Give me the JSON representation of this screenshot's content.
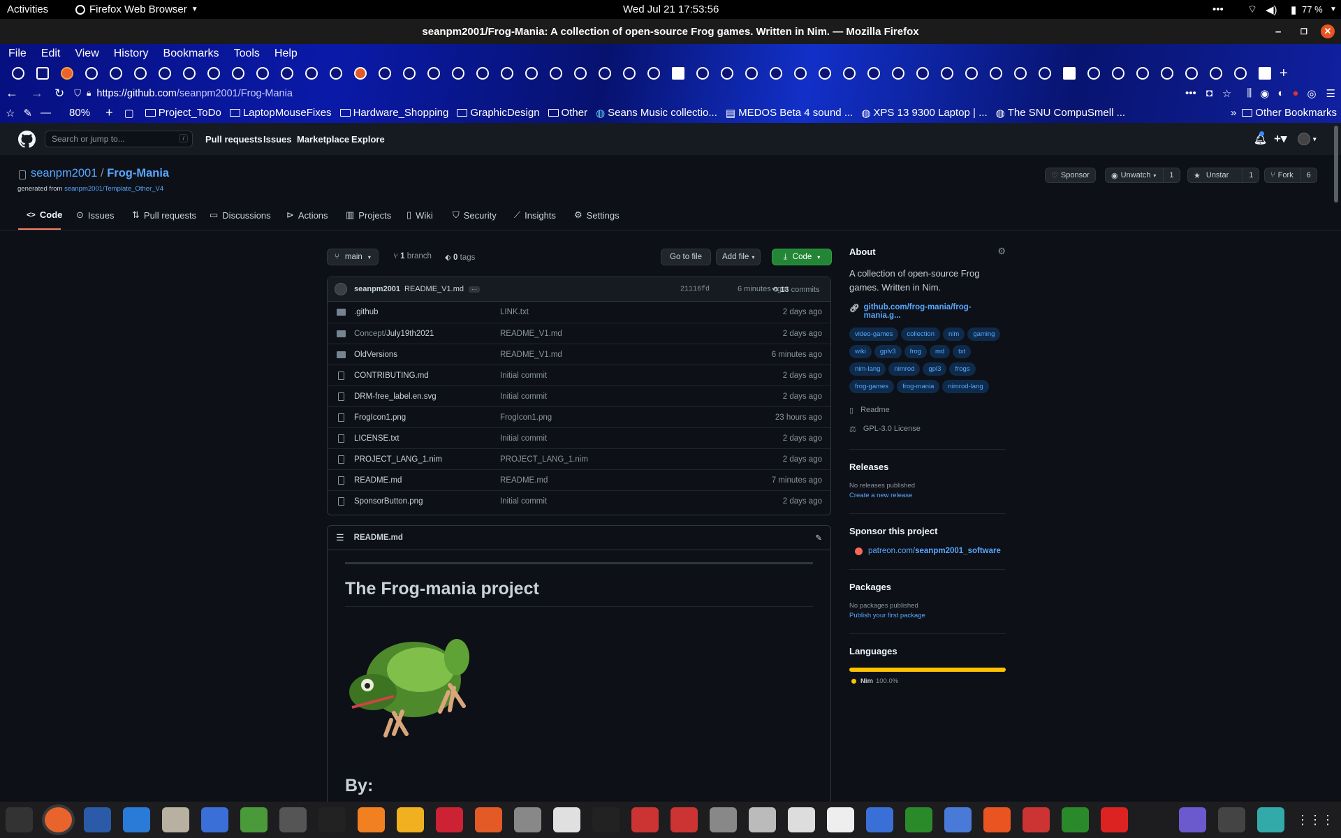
{
  "system": {
    "activities": "Activities",
    "app": "Firefox Web Browser",
    "clock": "Wed Jul 21  17:53:56",
    "battery": "77 %"
  },
  "window": {
    "title": "seanpm2001/Frog-Mania: A collection of open-source Frog games. Written in Nim. — Mozilla Firefox"
  },
  "menu": [
    "File",
    "Edit",
    "View",
    "History",
    "Bookmarks",
    "Tools",
    "Help"
  ],
  "nav": {
    "url_prefix": "https://github.com",
    "url_path": "/seanpm2001/Frog-Mania",
    "zoom": "80%"
  },
  "bookmarks": [
    "Project_ToDo",
    "LaptopMouseFixes",
    "Hardware_Shopping",
    "GraphicDesign",
    "Other",
    "Seans Music collectio...",
    "MEDOS Beta 4 sound ...",
    "XPS 13 9300 Laptop | ...",
    "The SNU CompuSmell ...",
    "Other Bookmarks"
  ],
  "gh": {
    "search_placeholder": "Search or jump to...",
    "search_key": "/",
    "nav": [
      "Pull requests",
      "Issues",
      "Marketplace",
      "Explore"
    ]
  },
  "repo": {
    "owner": "seanpm2001",
    "name": "Frog-Mania",
    "generated_prefix": "generated from ",
    "template": "seanpm2001/Template_Other_V4",
    "sponsor": "Sponsor",
    "unwatch": "Unwatch",
    "watch_count": "1",
    "unstar": "Unstar",
    "star_count": "1",
    "fork": "Fork",
    "fork_count": "6",
    "tabs": [
      "Code",
      "Issues",
      "Pull requests",
      "Discussions",
      "Actions",
      "Projects",
      "Wiki",
      "Security",
      "Insights",
      "Settings"
    ]
  },
  "branchbar": {
    "branch": "main",
    "branches_n": "1",
    "branches_label": "branch",
    "tags_n": "0",
    "tags_label": "tags",
    "goto": "Go to file",
    "addfile": "Add file",
    "code": "Code"
  },
  "commit": {
    "author": "seanpm2001",
    "message": "README_V1.md",
    "dots": "···",
    "hash": "21116fd",
    "time": "6 minutes ago",
    "count": "13",
    "count_label": "commits"
  },
  "files": [
    {
      "name": ".github",
      "msg": "LINK.txt",
      "time": "2 days ago",
      "dir": true
    },
    {
      "name_pre": "Concept/",
      "name": "July19th2021",
      "msg": "README_V1.md",
      "time": "2 days ago",
      "dir": true
    },
    {
      "name": "OldVersions",
      "msg": "README_V1.md",
      "time": "6 minutes ago",
      "dir": true
    },
    {
      "name": "CONTRIBUTING.md",
      "msg": "Initial commit",
      "time": "2 days ago",
      "dir": false
    },
    {
      "name": "DRM-free_label.en.svg",
      "msg": "Initial commit",
      "time": "2 days ago",
      "dir": false
    },
    {
      "name": "FrogIcon1.png",
      "msg": "FrogIcon1.png",
      "time": "23 hours ago",
      "dir": false
    },
    {
      "name": "LICENSE.txt",
      "msg": "Initial commit",
      "time": "2 days ago",
      "dir": false
    },
    {
      "name": "PROJECT_LANG_1.nim",
      "msg": "PROJECT_LANG_1.nim",
      "time": "2 days ago",
      "dir": false
    },
    {
      "name": "README.md",
      "msg": "README.md",
      "time": "7 minutes ago",
      "dir": false
    },
    {
      "name": "SponsorButton.png",
      "msg": "Initial commit",
      "time": "2 days ago",
      "dir": false
    }
  ],
  "readme": {
    "file": "README.md",
    "h1": "The Frog-mania project",
    "h2": "By:"
  },
  "about": {
    "title": "About",
    "desc": "A collection of open-source Frog games. Written in Nim.",
    "link": "github.com/frog-mania/frog-mania.g...",
    "topics": [
      "video-games",
      "collection",
      "nim",
      "gaming",
      "wiki",
      "gplv3",
      "frog",
      "md",
      "txt",
      "nim-lang",
      "nimrod",
      "gpl3",
      "frogs",
      "frog-games",
      "frog-mania",
      "nimrod-lang"
    ],
    "readme": "Readme",
    "license": "GPL-3.0 License"
  },
  "releases": {
    "title": "Releases",
    "none": "No releases published",
    "create": "Create a new release"
  },
  "sponsor": {
    "title": "Sponsor this project",
    "pre": "patreon.com/",
    "user": "seanpm2001_software"
  },
  "packages": {
    "title": "Packages",
    "none": "No packages published",
    "publish": "Publish your first package"
  },
  "languages": {
    "title": "Languages",
    "name": "Nim",
    "pct": "100.0%",
    "fill": 1.0,
    "color": "#ffc200"
  }
}
